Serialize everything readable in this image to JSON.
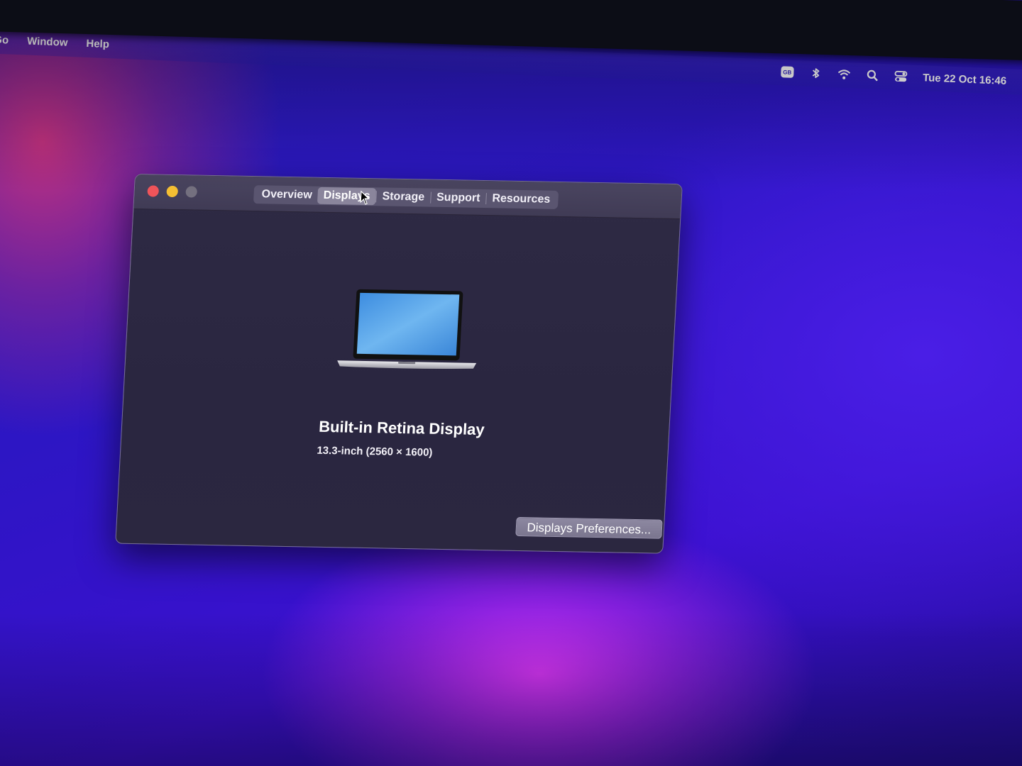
{
  "menubar": {
    "left_items": [
      "Go",
      "Window",
      "Help"
    ],
    "keyboard_badge": "GB",
    "datetime": "Tue 22 Oct  16:46"
  },
  "window": {
    "tabs": [
      "Overview",
      "Displays",
      "Storage",
      "Support",
      "Resources"
    ],
    "active_tab": "Displays",
    "display_name": "Built-in Retina Display",
    "display_spec": "13.3-inch (2560 × 1600)",
    "preferences_button": "Displays Preferences..."
  },
  "colors": {
    "close": "#f0545a",
    "minimize": "#f5bf33",
    "zoom_disabled": "#74707f"
  }
}
